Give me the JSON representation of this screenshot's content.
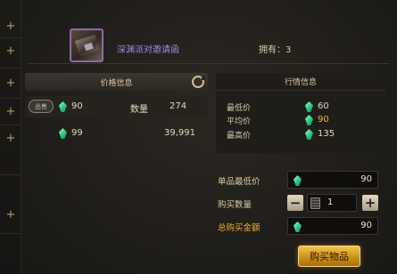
{
  "item": {
    "name": "深渊派对邀请函",
    "owned": "拥有：3"
  },
  "price_info": {
    "title": "价格信息",
    "sell_label": "出售",
    "rows": [
      {
        "price": "90",
        "qty_label": "数量",
        "qty": "274"
      },
      {
        "price": "99",
        "qty": "39,991"
      }
    ]
  },
  "market": {
    "title": "行情信息",
    "rows": [
      {
        "label": "最低价",
        "value": "60",
        "color": "#e3d8bd"
      },
      {
        "label": "平均价",
        "value": "90",
        "color": "#f1b233"
      },
      {
        "label": "最高价",
        "value": "135",
        "color": "#e3d8bd"
      }
    ]
  },
  "form": {
    "unit_price_label": "单品最低价",
    "unit_price": "90",
    "qty_label": "购买数量",
    "qty": "1",
    "total_label": "总购买金额",
    "total": "90",
    "buy_label": "购买物品"
  },
  "icons": [
    "gem-currency-icon",
    "refresh-icon",
    "plus-icon",
    "minus-icon",
    "calculator-icon"
  ]
}
